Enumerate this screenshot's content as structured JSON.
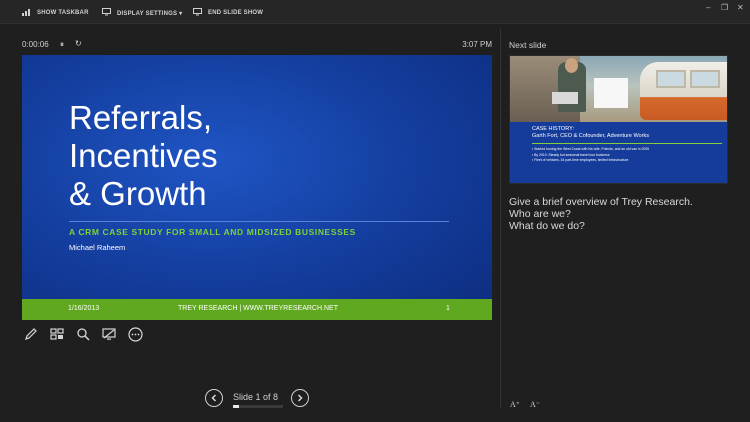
{
  "toolbar": {
    "show_taskbar": "SHOW TASKBAR",
    "display_settings": "DISPLAY SETTINGS ▾",
    "end_slide_show": "END SLIDE SHOW",
    "minimize_glyph": "–",
    "restore_glyph": "❐",
    "close_glyph": "✕"
  },
  "timer": {
    "elapsed": "0:00:06",
    "pause_glyph": "⏸",
    "reset_glyph": "↻",
    "clock": "3:07 PM"
  },
  "slide": {
    "title": "Referrals,\nIncentives\n& Growth",
    "subtitle": "A CRM CASE STUDY FOR SMALL AND MIDSIZED BUSINESSES",
    "author": "Michael Raheem",
    "footer_date": "1/16/2013",
    "footer_center": "TREY RESEARCH | WWW.TREYRESEARCH.NET",
    "footer_page": "1",
    "colors": {
      "background": "#123a98",
      "footer": "#5fa81f",
      "subtitle": "#7fd03a"
    }
  },
  "tools": [
    {
      "name": "pen-icon"
    },
    {
      "name": "see-all-slides-icon"
    },
    {
      "name": "zoom-icon"
    },
    {
      "name": "black-screen-icon"
    },
    {
      "name": "more-options-icon"
    }
  ],
  "navigation": {
    "prev_glyph": "◀",
    "next_glyph": "▶",
    "label": "Slide 1 of 8",
    "current": 1,
    "total": 8,
    "progress_fraction": 0.125
  },
  "next_slide": {
    "label": "Next slide",
    "heading": "CASE HISTORY:\nGarth Fort, CEO & Cofounder, Adventure Works",
    "bullets": [
      "Started touring the West Coast with his wife, Friends, and an old van in 2005",
      "By 2010: Steady but seasonal travel tour business",
      "Fleet of vehicles, 34 part-time employees, limited infrastructure"
    ]
  },
  "notes": "Give a brief overview of Trey Research.\nWho are we?\nWhat do we do?",
  "font_controls": {
    "increase": "A⁺",
    "decrease": "A⁻"
  }
}
